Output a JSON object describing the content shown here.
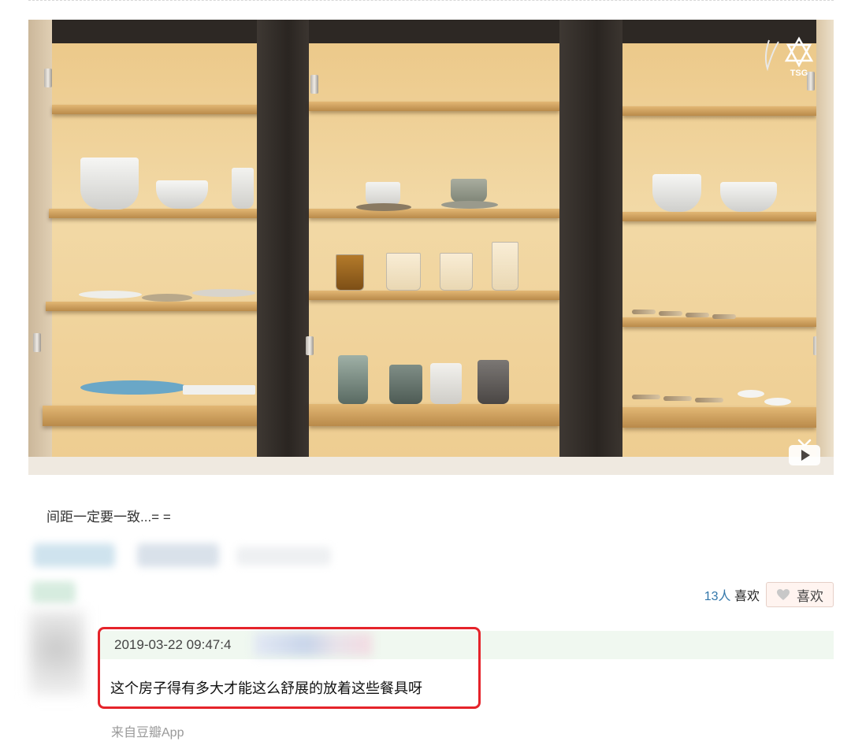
{
  "post": {
    "caption": "间距一定要一致...= ="
  },
  "video": {
    "logo_text": "TSG"
  },
  "likes": {
    "count": "13人",
    "count_suffix": " 喜欢",
    "button_label": "喜欢"
  },
  "comment": {
    "timestamp": "2019-03-22 09:47:4",
    "text": "这个房子得有多大才能这么舒展的放着这些餐具呀",
    "source": "来自豆瓣App"
  },
  "colors": {
    "highlight": "#e5232a",
    "link": "#3377aa",
    "comment_bar": "#f0f8f0"
  }
}
